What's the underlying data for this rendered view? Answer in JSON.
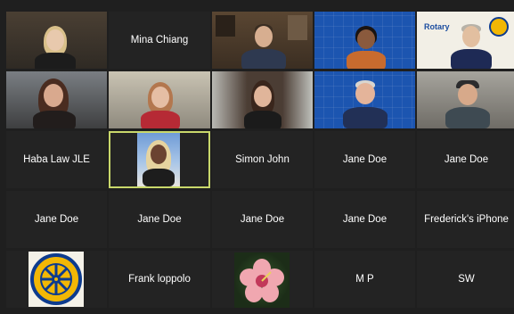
{
  "meeting": {
    "view": "gallery",
    "participants": [
      {
        "label": "",
        "kind": "video"
      },
      {
        "label": "Mina Chiang",
        "kind": "name"
      },
      {
        "label": "",
        "kind": "video"
      },
      {
        "label": "",
        "kind": "video"
      },
      {
        "label": "",
        "kind": "video"
      },
      {
        "label": "",
        "kind": "video"
      },
      {
        "label": "",
        "kind": "video"
      },
      {
        "label": "",
        "kind": "video"
      },
      {
        "label": "",
        "kind": "video"
      },
      {
        "label": "",
        "kind": "video"
      },
      {
        "label": "Haba Law JLE",
        "kind": "name"
      },
      {
        "label": "",
        "kind": "video",
        "active_speaker": true
      },
      {
        "label": "Simon John",
        "kind": "name"
      },
      {
        "label": "Jane Doe",
        "kind": "name"
      },
      {
        "label": "Jane Doe",
        "kind": "name"
      },
      {
        "label": "Jane Doe",
        "kind": "name"
      },
      {
        "label": "Jane Doe",
        "kind": "name"
      },
      {
        "label": "Jane Doe",
        "kind": "name"
      },
      {
        "label": "Jane Doe",
        "kind": "name"
      },
      {
        "label": "Frederick's iPhone",
        "kind": "name"
      },
      {
        "label": "",
        "kind": "profile-image"
      },
      {
        "label": "Frank loppolo",
        "kind": "name"
      },
      {
        "label": "",
        "kind": "profile-image"
      },
      {
        "label": "M P",
        "kind": "name"
      },
      {
        "label": "SW",
        "kind": "name"
      }
    ]
  },
  "backdrop_text": {
    "rotary": "Rotary"
  },
  "colors": {
    "background": "#1f1f1f",
    "tile": "#232323",
    "active_border": "#c9d86b",
    "rotary_blue": "#1c55b0",
    "rotary_gold": "#f2b705"
  }
}
